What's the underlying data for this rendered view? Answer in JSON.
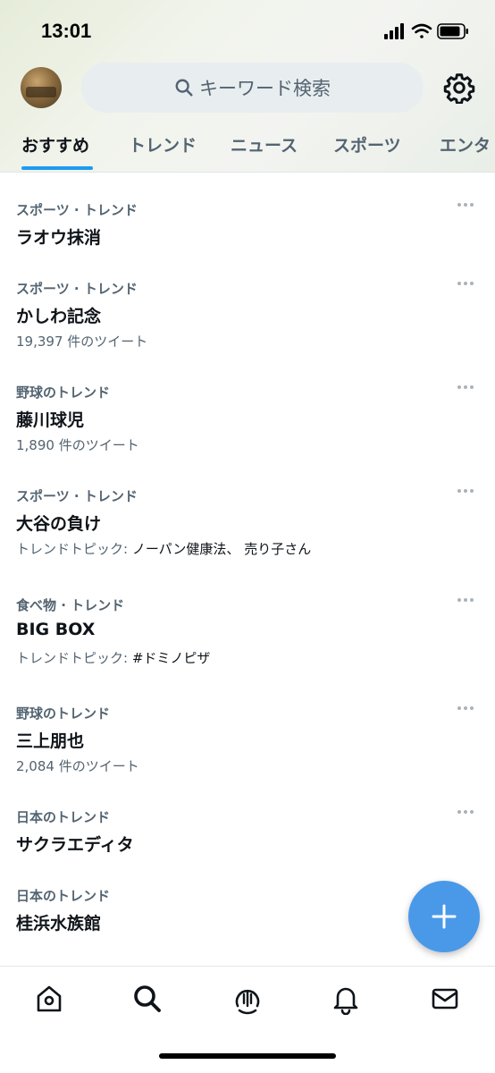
{
  "status": {
    "time": "13:01"
  },
  "search": {
    "placeholder": "キーワード検索"
  },
  "tabs": [
    {
      "label": "おすすめ",
      "active": true
    },
    {
      "label": "トレンド",
      "active": false
    },
    {
      "label": "ニュース",
      "active": false
    },
    {
      "label": "スポーツ",
      "active": false
    },
    {
      "label": "エンタ",
      "active": false
    }
  ],
  "trends": [
    {
      "category": "スポーツ · トレンド",
      "name": "ラオウ抹消",
      "sub": ""
    },
    {
      "category": "スポーツ · トレンド",
      "name": "かしわ記念",
      "sub": "19,397 件のツイート"
    },
    {
      "category": "野球のトレンド",
      "name": "藤川球児",
      "sub": "1,890 件のツイート"
    },
    {
      "category": "スポーツ · トレンド",
      "name": "大谷の負け",
      "sub_prefix": "トレンドトピック: ",
      "sub_topics": "ノーパン健康法、 売り子さん"
    },
    {
      "category": "食べ物 · トレンド",
      "name": "BIG BOX",
      "sub_prefix": "トレンドトピック: ",
      "sub_topics": "#ドミノピザ"
    },
    {
      "category": "野球のトレンド",
      "name": "三上朋也",
      "sub": "2,084 件のツイート"
    },
    {
      "category": "日本のトレンド",
      "name": "サクラエディタ",
      "sub": ""
    },
    {
      "category": "日本のトレンド",
      "name": "桂浜水族館",
      "sub": ""
    }
  ],
  "bottom_nav": [
    "home-icon",
    "search-icon",
    "spaces-icon",
    "bell-icon",
    "mail-icon"
  ],
  "colors": {
    "accent": "#1d9bf0",
    "fab": "#4a99e9",
    "secondary_text": "#536471"
  }
}
